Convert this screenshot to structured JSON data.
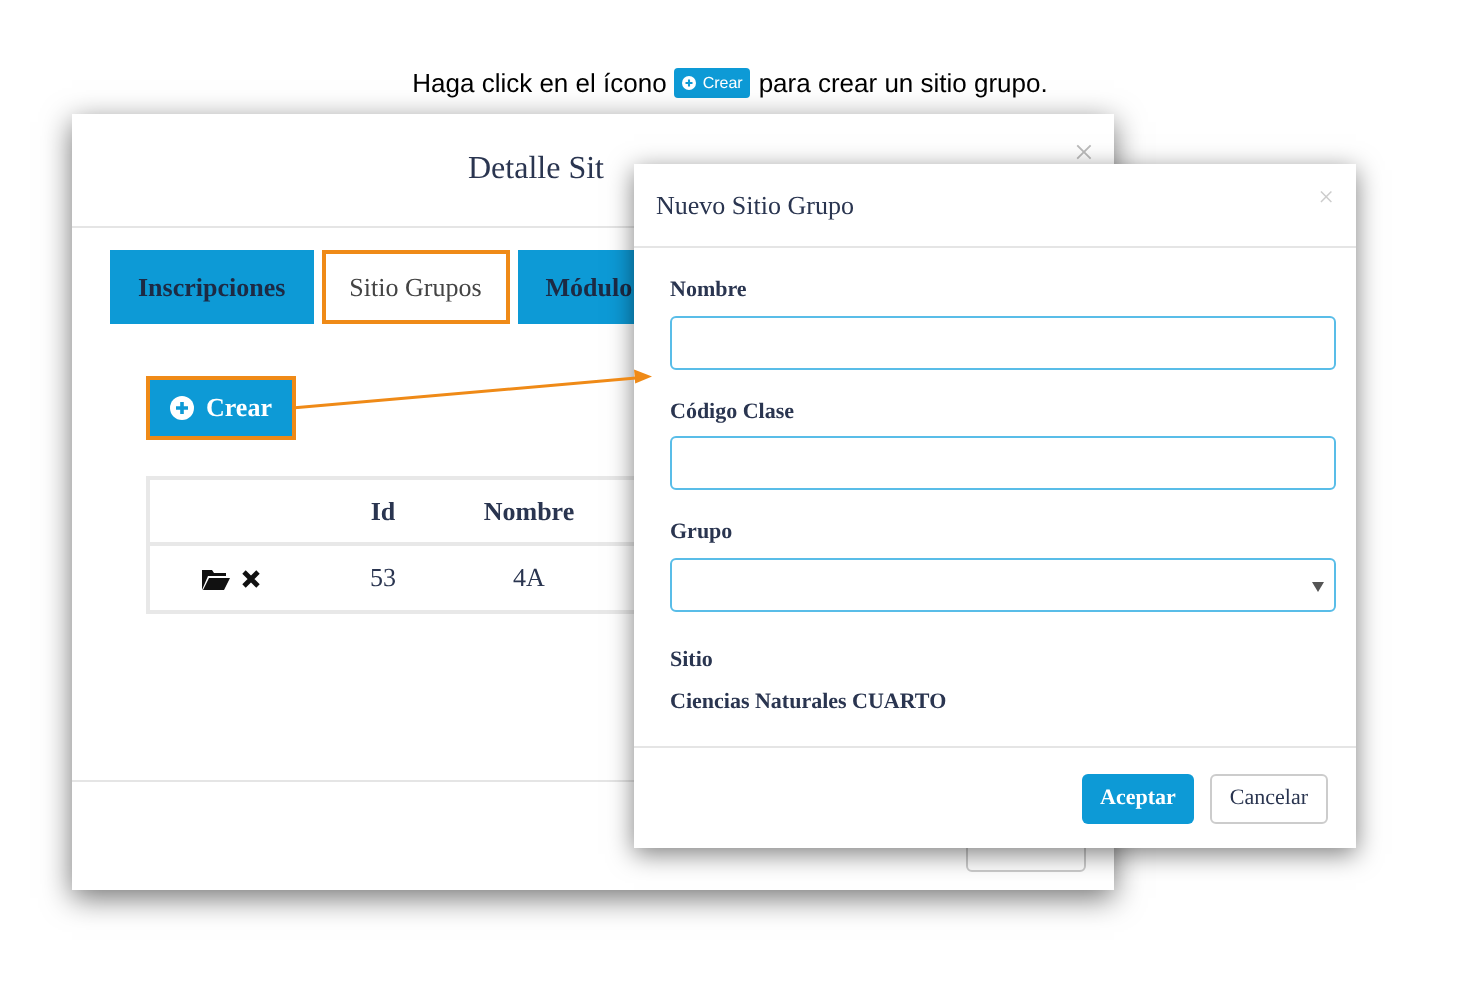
{
  "instruction": {
    "before": "Haga click en el ícono",
    "badge": "Crear",
    "after": "para crear un sitio grupo."
  },
  "back_dialog": {
    "title": "Detalle Sit",
    "close": "×",
    "tabs": [
      {
        "label": "Inscripciones",
        "selected": false
      },
      {
        "label": "Sitio Grupos",
        "selected": true
      },
      {
        "label": "Módulo",
        "selected": false
      }
    ],
    "create_button": "Crear",
    "table": {
      "columns": [
        "Id",
        "Nombre"
      ],
      "rows": [
        {
          "cells": [
            "53",
            "4A"
          ]
        }
      ]
    }
  },
  "dialog": {
    "title": "Nuevo Sitio Grupo",
    "close": "×",
    "fields": [
      {
        "kind": "text",
        "label": "Nombre"
      },
      {
        "kind": "text",
        "label": "Código Clase"
      },
      {
        "kind": "select",
        "label": "Grupo"
      }
    ],
    "site": {
      "label": "Sitio",
      "value": "Ciencias Naturales CUARTO"
    },
    "buttons": [
      {
        "kind": "primary",
        "label": "Aceptar"
      },
      {
        "kind": "default",
        "label": "Cancelar"
      }
    ]
  }
}
